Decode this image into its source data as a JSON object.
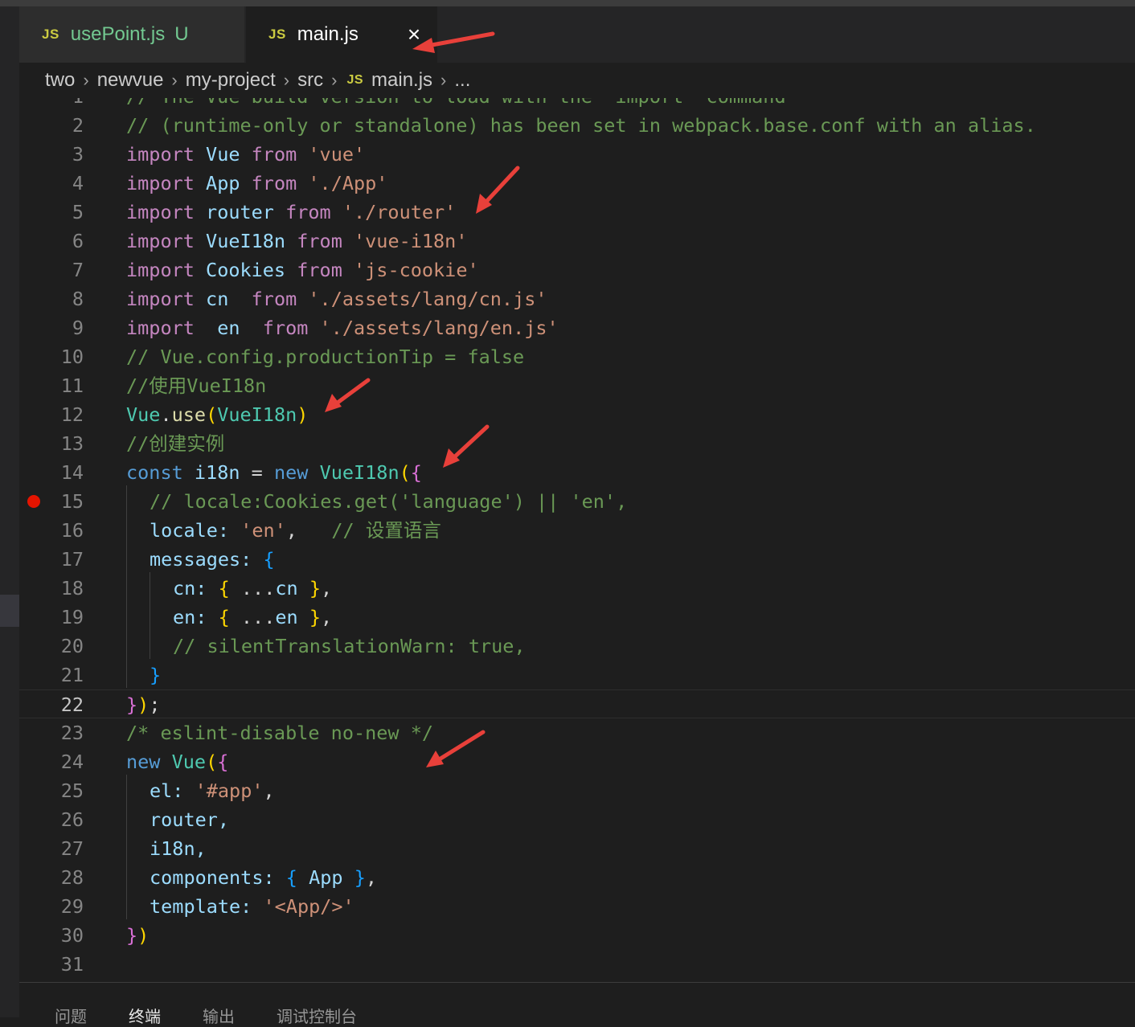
{
  "tabs": [
    {
      "icon": "JS",
      "label": "usePoint.js",
      "status": "U"
    },
    {
      "icon": "JS",
      "label": "main.js",
      "close": "×"
    }
  ],
  "breadcrumb": {
    "items": [
      "two",
      "newvue",
      "my-project",
      "src"
    ],
    "file_icon": "JS",
    "file": "main.js",
    "ellipsis": "..."
  },
  "editor": {
    "active_line": 22,
    "breakpoint_line": 15,
    "line_numbers": [
      "1",
      "2",
      "3",
      "4",
      "5",
      "6",
      "7",
      "8",
      "9",
      "10",
      "11",
      "12",
      "13",
      "14",
      "15",
      "16",
      "17",
      "18",
      "19",
      "20",
      "21",
      "22",
      "23",
      "24",
      "25",
      "26",
      "27",
      "28",
      "29",
      "30",
      "31"
    ],
    "lines": {
      "l1": "// The Vue build version to load with the `import` command",
      "l2": "// (runtime-only or standalone) has been set in webpack.base.conf with an alias.",
      "l3_kw": "import",
      "l3_id": "Vue",
      "l3_from": "from",
      "l3_str": "'vue'",
      "l4_kw": "import",
      "l4_id": "App",
      "l4_from": "from",
      "l4_str": "'./App'",
      "l5_kw": "import",
      "l5_id": "router",
      "l5_from": "from",
      "l5_str": "'./router'",
      "l6_kw": "import",
      "l6_id": "VueI18n",
      "l6_from": "from",
      "l6_str": "'vue-i18n'",
      "l7_kw": "import",
      "l7_id": "Cookies",
      "l7_from": "from",
      "l7_str": "'js-cookie'",
      "l8_kw": "import",
      "l8_id": "cn ",
      "l8_from": "from",
      "l8_str": "'./assets/lang/cn.js'",
      "l9_kw": "import",
      "l9_id": " en ",
      "l9_from": "from",
      "l9_str": "'./assets/lang/en.js'",
      "l10": "// Vue.config.productionTip = false",
      "l11": "//使用VueI18n",
      "l12_obj": "Vue",
      "l12_dot": ".",
      "l12_fn": "use",
      "l12_open": "(",
      "l12_arg": "VueI18n",
      "l12_close": ")",
      "l13": "//创建实例",
      "l14_const": "const",
      "l14_name": "i18n",
      "l14_eq": " = ",
      "l14_new": "new",
      "l14_cls": "VueI18n",
      "l14_paren": "(",
      "l14_brace": "{",
      "l15": "// locale:Cookies.get('language') || 'en',",
      "l16_key": "locale:",
      "l16_str": "'en'",
      "l16_comma": ",",
      "l16_comment": "// 设置语言",
      "l17_key": "messages:",
      "l17_brace": "{",
      "l18_key": "cn:",
      "l18_open": "{",
      "l18_spread": " ...",
      "l18_id": "cn",
      "l18_close": "}",
      "l18_comma": ",",
      "l19_key": "en:",
      "l19_open": "{",
      "l19_spread": " ...",
      "l19_id": "en",
      "l19_close": "}",
      "l19_comma": ",",
      "l20": "// silentTranslationWarn: true,",
      "l21": "}",
      "l22_brace": "}",
      "l22_paren": ")",
      "l22_semi": ";",
      "l23": "/* eslint-disable no-new */",
      "l24_new": "new",
      "l24_cls": "Vue",
      "l24_paren": "(",
      "l24_brace": "{",
      "l25_key": "el:",
      "l25_str": "'#app'",
      "l25_comma": ",",
      "l26": "router,",
      "l27": "i18n,",
      "l28_key": "components:",
      "l28_open": "{",
      "l28_id": "App",
      "l28_close": "}",
      "l28_comma": ",",
      "l29_key": "template:",
      "l29_str": "'<App/>'",
      "l30_brace": "}",
      "l30_paren": ")"
    }
  },
  "panel_tabs": [
    "问题",
    "终端",
    "输出",
    "调试控制台"
  ],
  "colors": {
    "keyword": "#569cd6",
    "control": "#c586c0",
    "string": "#ce9178",
    "comment": "#6a9955",
    "variable": "#9cdcfe",
    "class": "#4ec9b0",
    "function": "#dcdcaa",
    "annotation_arrow": "#e8403a",
    "breakpoint": "#e51400"
  }
}
